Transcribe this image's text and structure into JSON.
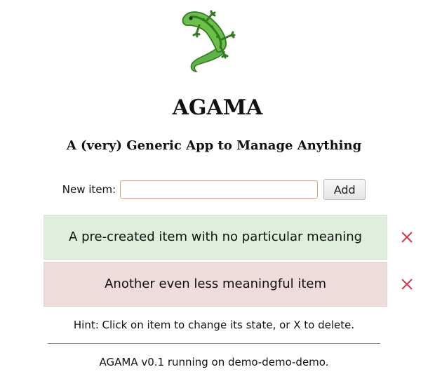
{
  "app": {
    "title": "AGAMA",
    "subtitle": "A (very) Generic App to Manage Anything"
  },
  "form": {
    "label": "New item:",
    "value": "",
    "placeholder": "",
    "add_label": "Add"
  },
  "items": [
    {
      "text": "A pre-created item with no particular meaning",
      "state_color": "#dfeedd"
    },
    {
      "text": "Another even less meaningful item",
      "state_color": "#eddcdb"
    }
  ],
  "colors": {
    "delete": "#d9323e",
    "logo_dark": "#2f7d20",
    "logo_light": "#6cc04a"
  },
  "hint": "Hint: Click on item to change its state, or X to delete.",
  "footer": "AGAMA v0.1 running on demo-demo-demo."
}
